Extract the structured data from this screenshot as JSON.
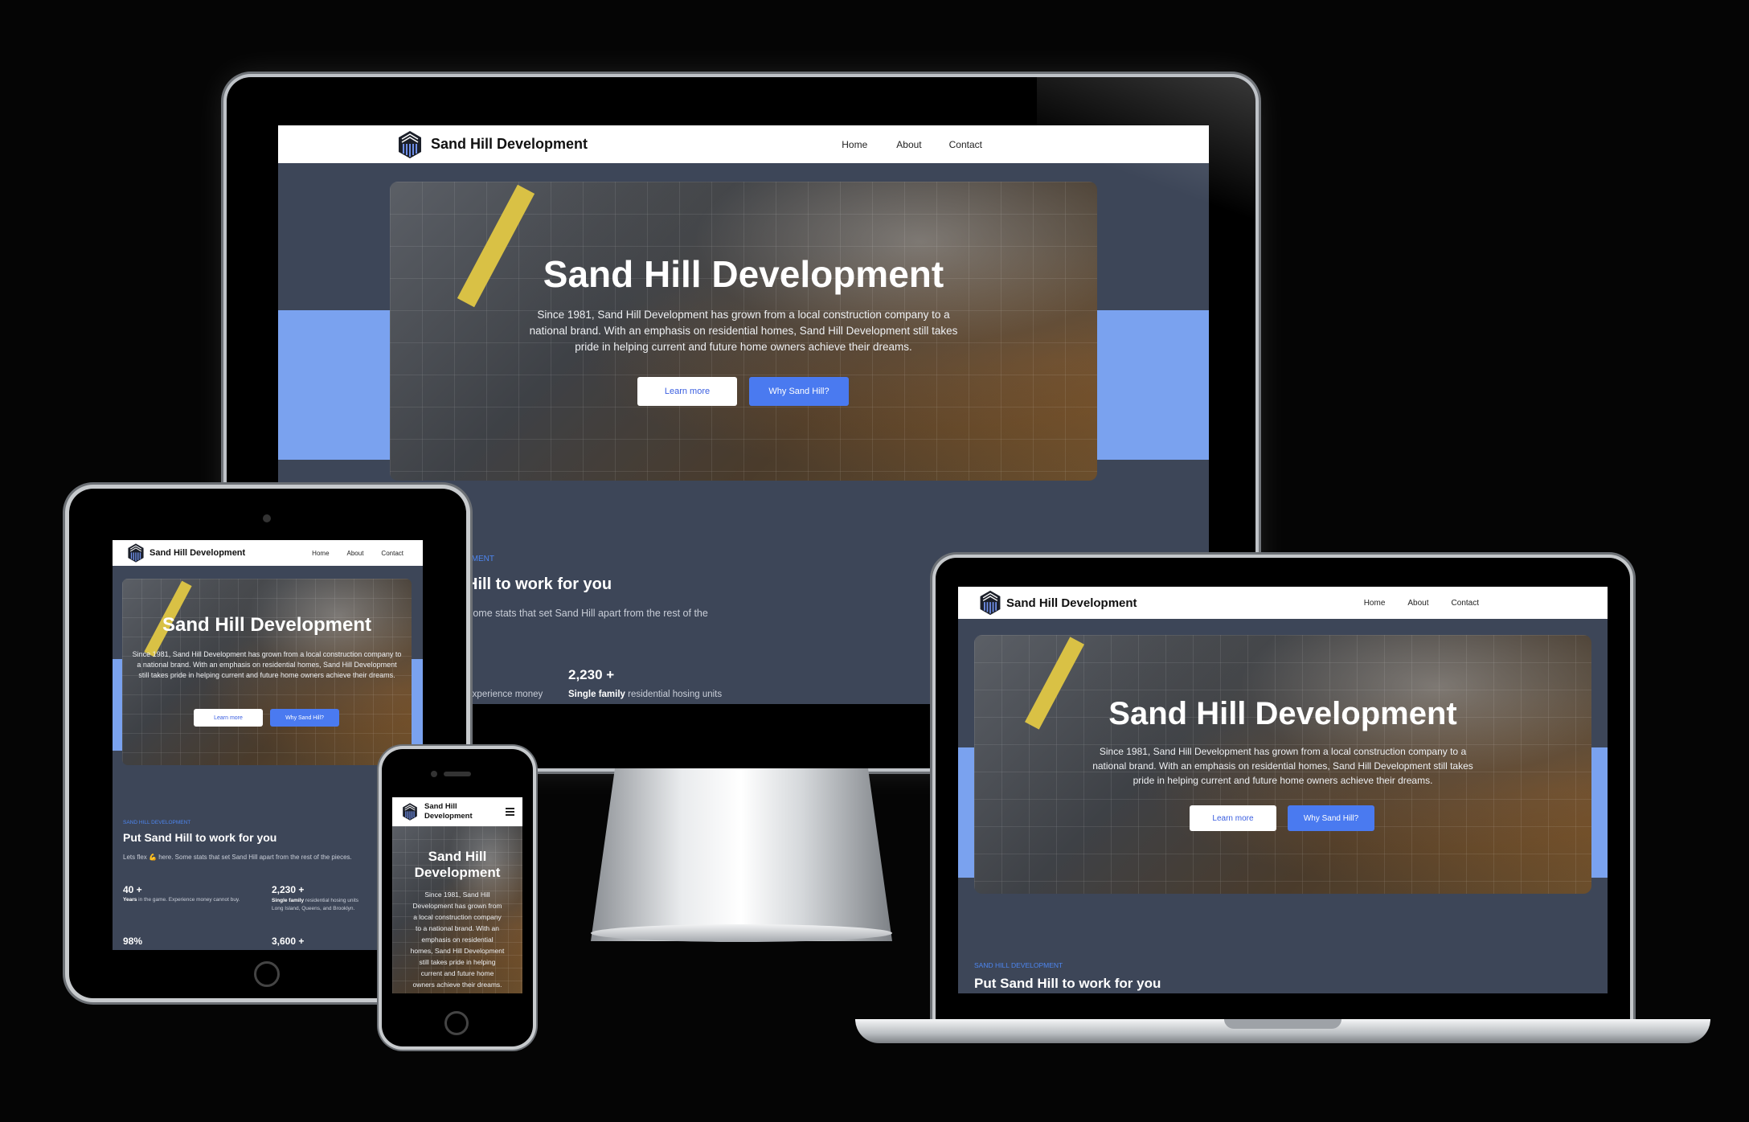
{
  "site": {
    "brand": "Sand Hill Development",
    "brand_line1": "Sand Hill",
    "brand_line2": "Development",
    "nav": {
      "home": "Home",
      "about": "About",
      "contact": "Contact"
    },
    "hero": {
      "title": "Sand Hill Development",
      "title_line1": "Sand Hill",
      "title_line2": "Development",
      "text": "Since 1981, Sand Hill Development has grown from a local construction company to a national brand. With an emphasis on residential homes, Sand Hill Development still takes pride in helping current and future home owners achieve their dreams.",
      "learn_more": "Learn more",
      "why": "Why Sand Hill?"
    },
    "section": {
      "kicker": "SAND HILL DEVELOPMENT",
      "kicker_fragment": "PMENT",
      "heading": "Put Sand Hill to work for you",
      "heading_fragment": "Hill to work for you",
      "intro": "Lets flex 💪 here. Some stats that set Sand Hill apart from the rest of the pieces.",
      "intro_fragment": "Some stats that set Sand Hill apart from the rest of the"
    },
    "stats": [
      {
        "value": "40 +",
        "label_bold": "Years",
        "label_rest": " in the game. Experience money cannot buy."
      },
      {
        "value": "2,230 +",
        "label_bold": "Single family",
        "label_rest": " residential hosing units"
      },
      {
        "value": "98%",
        "label_bold": "",
        "label_rest": ""
      },
      {
        "value": "3,600 +",
        "label_bold": "",
        "label_rest": ""
      }
    ],
    "tablet_stat2_sub": "Long Island, Queens, and Brooklyn.",
    "imac_stat1_fragment": "Experience money"
  },
  "colors": {
    "page_bg": "#3d4658",
    "accent": "#4a7af0",
    "band": "#7aa2ef",
    "kicker": "#4d86f0"
  }
}
